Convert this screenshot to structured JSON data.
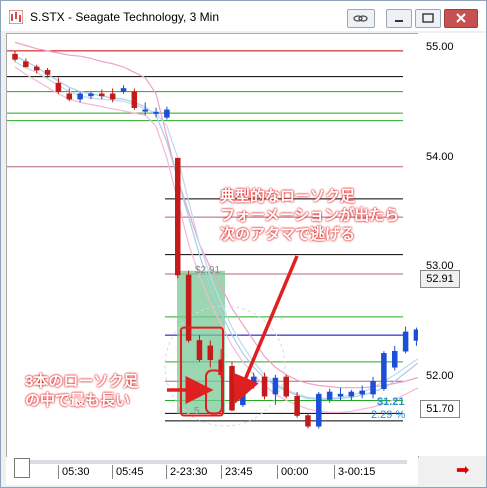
{
  "window": {
    "title": "S.STX - Seagate Technology, 3 Min"
  },
  "y_axis": {
    "ticks": [
      "55.00",
      "54.00",
      "53.00",
      "52.00"
    ],
    "price_label_upper": "52.91",
    "price_label_lower": "51.70"
  },
  "x_axis": {
    "ticks": [
      "05:30",
      "05:45",
      "2-23:30",
      "23:45",
      "00:00",
      "3-00:15"
    ]
  },
  "overlay": {
    "gap_label": "$2.91",
    "change_value": "$1.21",
    "change_percent": "2.29 %",
    "small_marker": "5"
  },
  "annotations": {
    "top": [
      "典型的なローソク足",
      "フォーメーションが出たら",
      "次のアタマで逃げる"
    ],
    "bottom": [
      "3本のローソク足",
      "の中で最も長い"
    ]
  },
  "colors": {
    "up_candle": "#1a4fd6",
    "down_candle": "#c41a1a",
    "annotation_red": "#e02020",
    "highlight_green": "#78c896"
  },
  "chart_data": {
    "type": "candlestick",
    "ylim": [
      51.6,
      55.1
    ],
    "candles": [
      {
        "o": 54.97,
        "h": 55.0,
        "l": 54.9,
        "c": 54.92
      },
      {
        "o": 54.9,
        "h": 54.93,
        "l": 54.85,
        "c": 54.85
      },
      {
        "o": 54.85,
        "h": 54.87,
        "l": 54.79,
        "c": 54.82
      },
      {
        "o": 54.82,
        "h": 54.84,
        "l": 54.75,
        "c": 54.78
      },
      {
        "o": 54.7,
        "h": 54.75,
        "l": 54.6,
        "c": 54.62
      },
      {
        "o": 54.6,
        "h": 54.65,
        "l": 54.53,
        "c": 54.55
      },
      {
        "o": 54.55,
        "h": 54.62,
        "l": 54.52,
        "c": 54.6
      },
      {
        "o": 54.58,
        "h": 54.62,
        "l": 54.55,
        "c": 54.6
      },
      {
        "o": 54.6,
        "h": 54.64,
        "l": 54.55,
        "c": 54.58
      },
      {
        "o": 54.6,
        "h": 54.65,
        "l": 54.52,
        "c": 54.55
      },
      {
        "o": 54.62,
        "h": 54.68,
        "l": 54.6,
        "c": 54.65
      },
      {
        "o": 54.62,
        "h": 54.65,
        "l": 54.45,
        "c": 54.47
      },
      {
        "o": 54.45,
        "h": 54.52,
        "l": 54.4,
        "c": 54.45
      },
      {
        "o": 54.43,
        "h": 54.47,
        "l": 54.38,
        "c": 54.43
      },
      {
        "o": 54.38,
        "h": 54.48,
        "l": 54.36,
        "c": 54.45
      },
      {
        "o": 54.0,
        "h": 54.0,
        "l": 52.88,
        "c": 52.91
      },
      {
        "o": 52.91,
        "h": 52.95,
        "l": 52.28,
        "c": 52.3
      },
      {
        "o": 52.3,
        "h": 52.35,
        "l": 52.1,
        "c": 52.12
      },
      {
        "o": 52.25,
        "h": 52.3,
        "l": 52.05,
        "c": 52.12
      },
      {
        "o": 52.12,
        "h": 52.22,
        "l": 51.95,
        "c": 51.98
      },
      {
        "o": 52.06,
        "h": 52.1,
        "l": 51.64,
        "c": 51.65
      },
      {
        "o": 51.7,
        "h": 51.95,
        "l": 51.68,
        "c": 51.92
      },
      {
        "o": 51.9,
        "h": 52.0,
        "l": 51.85,
        "c": 51.96
      },
      {
        "o": 51.96,
        "h": 52.0,
        "l": 51.75,
        "c": 51.78
      },
      {
        "o": 51.8,
        "h": 51.98,
        "l": 51.7,
        "c": 51.95
      },
      {
        "o": 51.96,
        "h": 51.98,
        "l": 51.76,
        "c": 51.78
      },
      {
        "o": 51.78,
        "h": 51.82,
        "l": 51.58,
        "c": 51.6
      },
      {
        "o": 51.6,
        "h": 51.62,
        "l": 51.48,
        "c": 51.5
      },
      {
        "o": 51.5,
        "h": 51.82,
        "l": 51.48,
        "c": 51.8
      },
      {
        "o": 51.75,
        "h": 51.85,
        "l": 51.72,
        "c": 51.82
      },
      {
        "o": 51.78,
        "h": 51.86,
        "l": 51.74,
        "c": 51.8
      },
      {
        "o": 51.78,
        "h": 51.84,
        "l": 51.74,
        "c": 51.82
      },
      {
        "o": 51.8,
        "h": 51.88,
        "l": 51.76,
        "c": 51.83
      },
      {
        "o": 51.8,
        "h": 51.96,
        "l": 51.76,
        "c": 51.92
      },
      {
        "o": 51.85,
        "h": 52.2,
        "l": 51.83,
        "c": 52.18
      },
      {
        "o": 52.05,
        "h": 52.25,
        "l": 52.02,
        "c": 52.2
      },
      {
        "o": 52.2,
        "h": 52.43,
        "l": 52.18,
        "c": 52.38
      },
      {
        "o": 52.3,
        "h": 52.42,
        "l": 52.25,
        "c": 52.4
      },
      {
        "o": 52.32,
        "h": 52.45,
        "l": 52.28,
        "c": 52.38
      },
      {
        "o": 52.3,
        "h": 52.54,
        "l": 52.26,
        "c": 52.5
      }
    ],
    "horizontal_levels": [
      {
        "price": 55.0,
        "color": "#c00000"
      },
      {
        "price": 54.76,
        "color": "#000000"
      },
      {
        "price": 54.62,
        "color": "#22aa22"
      },
      {
        "price": 54.42,
        "color": "#22aa22"
      },
      {
        "price": 54.35,
        "color": "#22aa22"
      },
      {
        "price": 53.92,
        "color": "#b06080"
      },
      {
        "price": 53.62,
        "color": "#000000"
      },
      {
        "price": 53.45,
        "color": "#b06080"
      },
      {
        "price": 53.1,
        "color": "#000000"
      },
      {
        "price": 52.92,
        "color": "#b06080"
      },
      {
        "price": 52.52,
        "color": "#22aa22"
      },
      {
        "price": 52.35,
        "color": "#0000c0"
      },
      {
        "price": 52.1,
        "color": "#22aa22"
      },
      {
        "price": 51.92,
        "color": "#b06080"
      },
      {
        "price": 51.74,
        "color": "#22aa22"
      },
      {
        "price": 51.62,
        "color": "#000000"
      },
      {
        "price": 51.55,
        "color": "#000000"
      }
    ]
  }
}
